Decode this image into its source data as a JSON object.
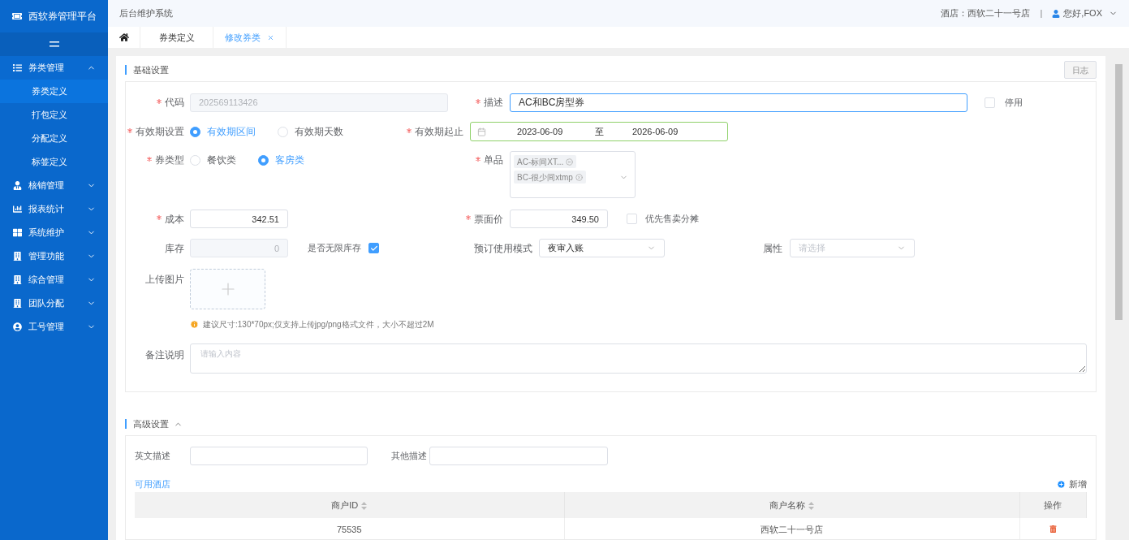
{
  "brand": "西软券管理平台",
  "header": {
    "system_title": "后台维护系统",
    "hotel": "酒店：西软二十一号店",
    "separator": "|",
    "user": "您好,FOX"
  },
  "sidebar": {
    "items": [
      {
        "label": "券类管理",
        "expanded": true,
        "children": [
          {
            "label": "券类定义",
            "selected": true
          },
          {
            "label": "打包定义",
            "selected": false
          },
          {
            "label": "分配定义",
            "selected": false
          },
          {
            "label": "标签定义",
            "selected": false
          }
        ]
      },
      {
        "label": "核销管理",
        "expanded": false
      },
      {
        "label": "报表统计",
        "expanded": false
      },
      {
        "label": "系统维护",
        "expanded": false
      },
      {
        "label": "管理功能",
        "expanded": false
      },
      {
        "label": "综合管理",
        "expanded": false
      },
      {
        "label": "团队分配",
        "expanded": false
      },
      {
        "label": "工号管理",
        "expanded": false
      }
    ]
  },
  "tabs": [
    {
      "kind": "home",
      "selected": false
    },
    {
      "kind": "tab",
      "label": "券类定义",
      "selected": false,
      "closable": false
    },
    {
      "kind": "tab",
      "label": "修改券类",
      "selected": true,
      "closable": true
    }
  ],
  "basic": {
    "title": "基础设置",
    "log_button": "日志",
    "code": {
      "label": "代码",
      "required": true,
      "value": "202569113426",
      "disabled": true
    },
    "description": {
      "label": "描述",
      "required": true,
      "value": "AC和BC房型券",
      "focused": true
    },
    "disabled_check": {
      "label": "停用",
      "checked": false
    },
    "validity_setting": {
      "label": "有效期设置",
      "required": true,
      "options": [
        {
          "label": "有效期区间",
          "selected": true
        },
        {
          "label": "有效期天数",
          "selected": false
        }
      ]
    },
    "validity_range": {
      "label": "有效期起止",
      "required": true,
      "start": "2023-06-09",
      "separator": "至",
      "end": "2026-06-09"
    },
    "voucher_type": {
      "label": "券类型",
      "required": true,
      "options": [
        {
          "label": "餐饮类",
          "selected": false
        },
        {
          "label": "客房类",
          "selected": true
        }
      ]
    },
    "items": {
      "label": "单品",
      "required": true,
      "tags": [
        "AC-标间XT...",
        "BC-很少间xtmp"
      ]
    },
    "cost": {
      "label": "成本",
      "required": true,
      "value": "342.51"
    },
    "face_value": {
      "label": "票面价",
      "required": true,
      "value": "349.50"
    },
    "priority_check": {
      "label": "优先售卖分摊",
      "checked": false
    },
    "stock": {
      "label": "库存",
      "value": "0",
      "disabled": true
    },
    "unlimited_check": {
      "label": "是否无限库存",
      "checked": true
    },
    "booking_mode": {
      "label": "预订使用模式",
      "value": "夜审入账"
    },
    "attribute": {
      "label": "属性",
      "placeholder": "请选择"
    },
    "upload": {
      "label": "上传图片",
      "hint": "建议尺寸:130*70px;仅支持上传jpg/png格式文件，大小不超过2M"
    },
    "remark": {
      "label": "备注说明",
      "placeholder": "请输入内容"
    }
  },
  "advanced": {
    "title": "高级设置",
    "expanded": true,
    "english_desc": {
      "label": "英文描述"
    },
    "other_desc": {
      "label": "其他描述"
    },
    "hotels_title": "可用酒店",
    "add_button": "新增",
    "table": {
      "columns": [
        {
          "label": "商户ID",
          "sortable": true
        },
        {
          "label": "商户名称",
          "sortable": true
        },
        {
          "label": "操作",
          "sortable": false
        }
      ],
      "rows": [
        [
          "75535",
          "西软二十一号店"
        ]
      ]
    }
  }
}
